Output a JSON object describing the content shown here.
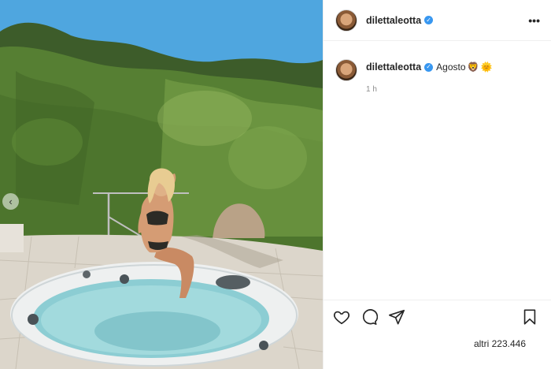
{
  "post": {
    "author": "dilettaleotta",
    "caption": "Agosto",
    "caption_emojis": [
      "🦁",
      "🌞"
    ],
    "time_ago": "1 h",
    "likes_text": "altri 223.446"
  },
  "icons": {
    "more": "more-options-icon",
    "like": "heart-icon",
    "comment": "comment-icon",
    "share": "paper-plane-icon",
    "save": "bookmark-icon",
    "verified": "verified-badge-icon",
    "prev": "chevron-left-icon"
  },
  "colors": {
    "verified": "#3897f0",
    "sky": "#4aa3e0",
    "hedge": "#4f7a2e",
    "water": "#9ed3d8",
    "muted_text": "#8e8e8e"
  }
}
